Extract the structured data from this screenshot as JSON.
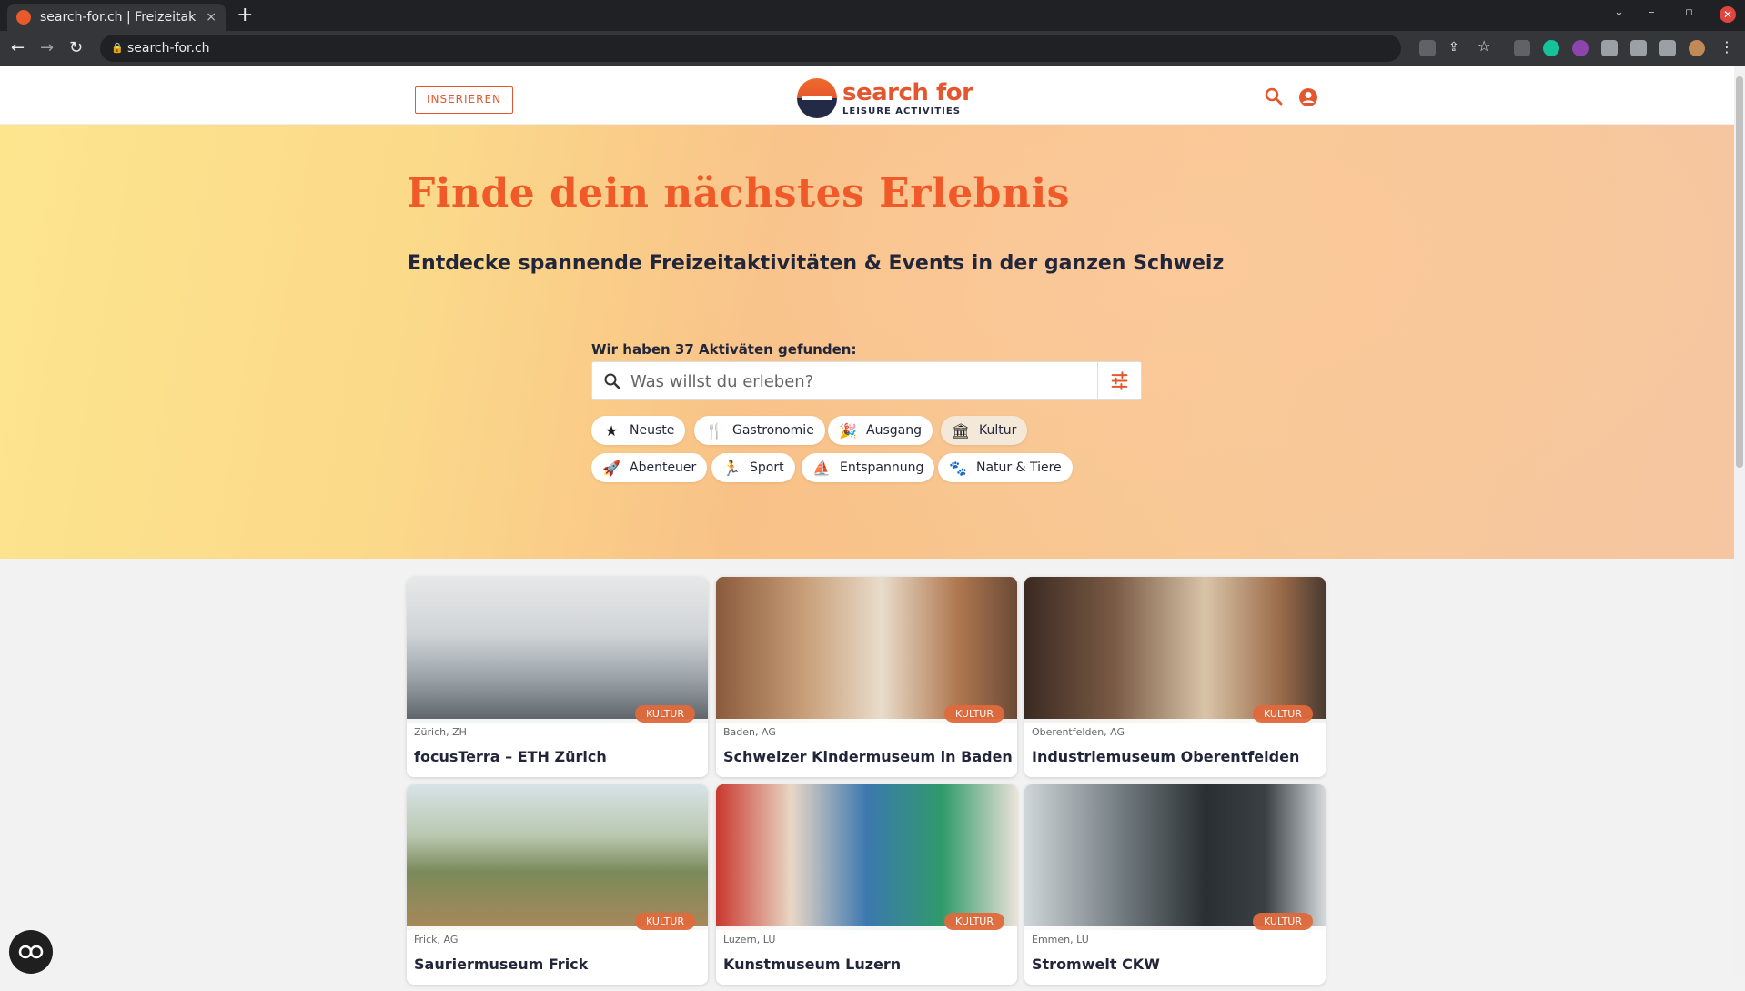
{
  "browser": {
    "tab_title": "search-for.ch | Freizeitak",
    "tab_close": "×",
    "new_tab": "+",
    "url": "search-for.ch",
    "win_min": "–",
    "win_max": "▫",
    "win_close": "✕"
  },
  "header": {
    "insert_label": "INSERIEREN",
    "logo_title": "search for",
    "logo_sub": "LEISURE ACTIVITIES"
  },
  "hero": {
    "title": "Finde dein nächstes Erlebnis",
    "subtitle": "Entdecke spannende Freizeitaktivitäten & Events in der ganzen Schweiz",
    "found_text": "Wir haben 37 Aktiväten gefunden:",
    "search_placeholder": "Was willst du erleben?"
  },
  "chips": [
    {
      "label": "Neuste",
      "icon": "star-icon",
      "glyph": "★"
    },
    {
      "label": "Gastronomie",
      "icon": "fork-knife-icon",
      "glyph": "🍴"
    },
    {
      "label": "Ausgang",
      "icon": "party-icon",
      "glyph": "🎉"
    },
    {
      "label": "Kultur",
      "icon": "museum-icon",
      "glyph": "🏛",
      "active": true
    },
    {
      "label": "Abenteuer",
      "icon": "rocket-icon",
      "glyph": "🚀"
    },
    {
      "label": "Sport",
      "icon": "runner-icon",
      "glyph": "🏃"
    },
    {
      "label": "Entspannung",
      "icon": "relax-icon",
      "glyph": "⛵"
    },
    {
      "label": "Natur & Tiere",
      "icon": "paw-icon",
      "glyph": "🐾"
    }
  ],
  "cards": [
    {
      "location": "Zürich, ZH",
      "name": "focusTerra – ETH Zürich",
      "badge": "KULTUR"
    },
    {
      "location": "Baden, AG",
      "name": "Schweizer Kindermuseum in Baden",
      "badge": "KULTUR"
    },
    {
      "location": "Oberentfelden, AG",
      "name": "Industriemuseum Oberentfelden",
      "badge": "KULTUR"
    },
    {
      "location": "Frick, AG",
      "name": "Sauriermuseum Frick",
      "badge": "KULTUR"
    },
    {
      "location": "Luzern, LU",
      "name": "Kunstmuseum Luzern",
      "badge": "KULTUR"
    },
    {
      "location": "Emmen, LU",
      "name": "Stromwelt CKW",
      "badge": "KULTUR"
    }
  ],
  "colors": {
    "brand": "#e4572e",
    "navy": "#22263a"
  }
}
